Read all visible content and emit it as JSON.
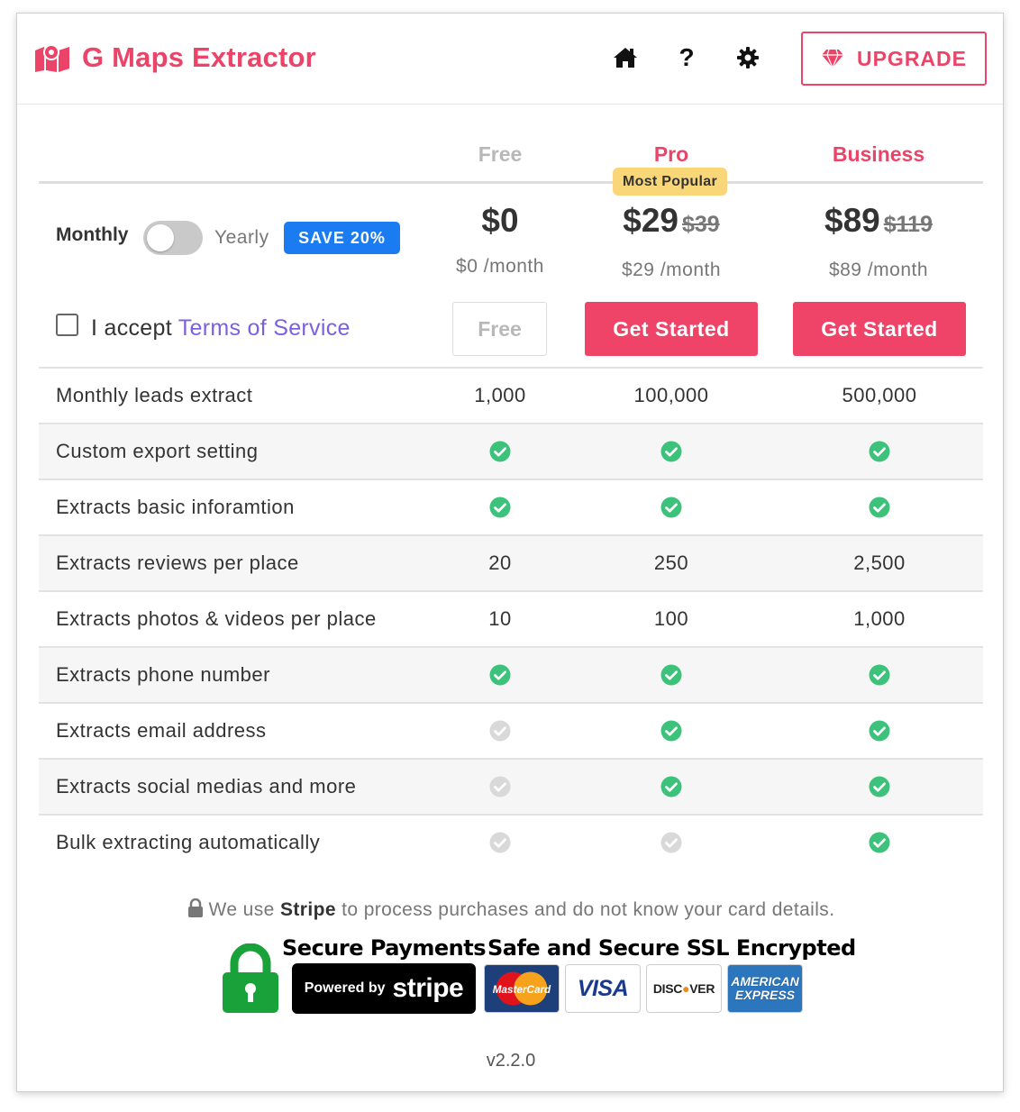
{
  "app": {
    "title": "G Maps Extractor",
    "brand_color": "#ec4468",
    "upgrade_label": "UPGRADE",
    "help_glyph": "?"
  },
  "plans": [
    {
      "name": "Free",
      "price": "$0",
      "old_price": "",
      "per_month": "$0 /month",
      "button": "Free",
      "badge": ""
    },
    {
      "name": "Pro",
      "price": "$29",
      "old_price": "$39",
      "per_month": "$29 /month",
      "button": "Get Started",
      "badge": "Most Popular"
    },
    {
      "name": "Business",
      "price": "$89",
      "old_price": "$119",
      "per_month": "$89 /month",
      "button": "Get Started",
      "badge": ""
    }
  ],
  "billing": {
    "monthly_label": "Monthly",
    "yearly_label": "Yearly",
    "save_label": "SAVE 20%",
    "yearly_selected": false
  },
  "terms": {
    "prefix": "I accept ",
    "link": "Terms of Service",
    "checked": false
  },
  "features": [
    {
      "name": "Monthly leads extract",
      "values": [
        "1,000",
        "100,000",
        "500,000"
      ]
    },
    {
      "name": "Custom export setting",
      "values": [
        "check",
        "check",
        "check"
      ]
    },
    {
      "name": "Extracts basic inforamtion",
      "values": [
        "check",
        "check",
        "check"
      ]
    },
    {
      "name": "Extracts reviews per place",
      "values": [
        "20",
        "250",
        "2,500"
      ]
    },
    {
      "name": "Extracts photos & videos per place",
      "values": [
        "10",
        "100",
        "1,000"
      ]
    },
    {
      "name": "Extracts phone number",
      "values": [
        "check",
        "check",
        "check"
      ]
    },
    {
      "name": "Extracts email address",
      "values": [
        "no",
        "check",
        "check"
      ]
    },
    {
      "name": "Extracts social medias and more",
      "values": [
        "no",
        "check",
        "check"
      ]
    },
    {
      "name": "Bulk extracting automatically",
      "values": [
        "no",
        "no",
        "check"
      ]
    }
  ],
  "footer": {
    "note_prefix": "We use ",
    "note_brand": "Stripe",
    "note_suffix": " to process purchases and do not know your card details.",
    "secure_payments": "Secure Payments",
    "powered_by": "Powered by",
    "stripe_brand": "stripe",
    "ssl_text": "Safe and Secure SSL Encrypted",
    "cards": {
      "mastercard": "MasterCard",
      "visa": "VISA",
      "discover_a": "DISC",
      "discover_b": "VER",
      "amex_1": "AMERICAN",
      "amex_2": "EXPRESS"
    },
    "version": "v2.2.0"
  },
  "colors": {
    "check_on": "#3cc27a",
    "check_off": "#d9d9d9",
    "save_badge": "#1a7cf0",
    "popular_badge": "#f9d779",
    "link": "#7b61e0"
  }
}
